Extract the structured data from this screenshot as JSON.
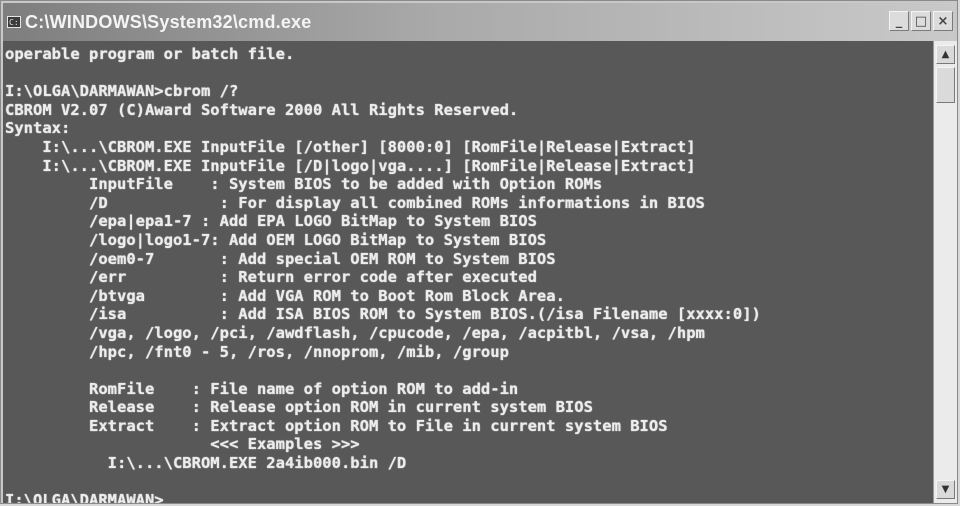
{
  "window": {
    "title": "C:\\WINDOWS\\System32\\cmd.exe",
    "icon": "cmd-icon",
    "controls": {
      "minimize": "_",
      "maximize": "□",
      "close": "×"
    }
  },
  "console": {
    "lines": [
      "operable program or batch file.",
      "",
      "I:\\OLGA\\DARMAWAN>cbrom /?",
      "CBROM V2.07 (C)Award Software 2000 All Rights Reserved.",
      "Syntax:",
      "    I:\\...\\CBROM.EXE InputFile [/other] [8000:0] [RomFile|Release|Extract]",
      "    I:\\...\\CBROM.EXE InputFile [/D|logo|vga....] [RomFile|Release|Extract]",
      "         InputFile    : System BIOS to be added with Option ROMs",
      "         /D            : For display all combined ROMs informations in BIOS",
      "         /epa|epa1-7 : Add EPA LOGO BitMap to System BIOS",
      "         /logo|logo1-7: Add OEM LOGO BitMap to System BIOS",
      "         /oem0-7       : Add special OEM ROM to System BIOS",
      "         /err          : Return error code after executed",
      "         /btvga        : Add VGA ROM to Boot Rom Block Area.",
      "         /isa          : Add ISA BIOS ROM to System BIOS.(/isa Filename [xxxx:0])",
      "         /vga, /logo, /pci, /awdflash, /cpucode, /epa, /acpitbl, /vsa, /hpm",
      "         /hpc, /fnt0 - 5, /ros, /nnoprom, /mib, /group",
      "",
      "         RomFile    : File name of option ROM to add-in",
      "         Release    : Release option ROM in current system BIOS",
      "         Extract    : Extract option ROM to File in current system BIOS",
      "                      <<< Examples >>>",
      "           I:\\...\\CBROM.EXE 2a4ib000.bin /D",
      "",
      "I:\\OLGA\\DARMAWAN>"
    ]
  },
  "scrollbar": {
    "up_arrow": "▲",
    "down_arrow": "▼"
  }
}
